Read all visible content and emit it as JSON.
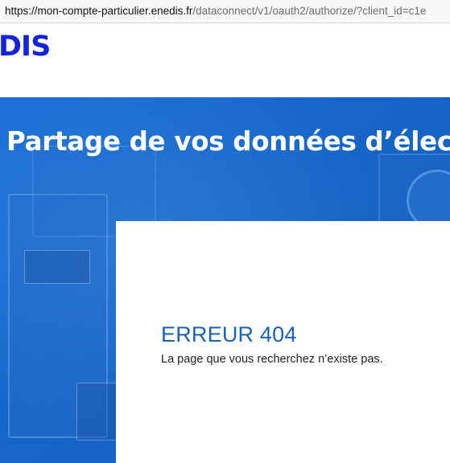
{
  "browser": {
    "url_domain": "https://mon-compte-particulier.enedis.fr",
    "url_rest": "/dataconnect/v1/oauth2/authorize/?client_id=c1e"
  },
  "header": {
    "logo_text": "DIS"
  },
  "hero": {
    "title": "Partage de vos données d’élect"
  },
  "error": {
    "title": "ERREUR 404",
    "message": "La page que vous recherchez n’existe pas."
  },
  "colors": {
    "brand_blue": "#1423dc",
    "hero_blue": "#1666c8",
    "error_title": "#1a62b8"
  }
}
